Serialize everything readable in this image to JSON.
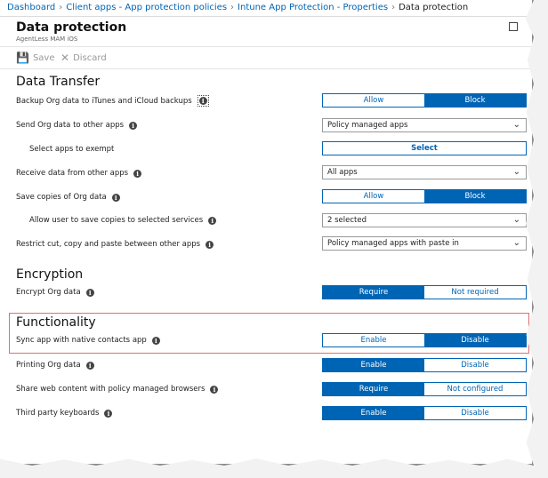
{
  "breadcrumb": {
    "items": [
      "Dashboard",
      "Client apps - App protection policies",
      "Intune App Protection - Properties"
    ],
    "current": "Data protection"
  },
  "header": {
    "title": "Data protection",
    "subtitle": "AgentLess MAM iOS"
  },
  "toolbar": {
    "save_label": "Save",
    "discard_label": "Discard"
  },
  "sections": {
    "data_transfer": "Data Transfer",
    "encryption": "Encryption",
    "functionality": "Functionality"
  },
  "rows": {
    "backup": {
      "label": "Backup Org data to iTunes and iCloud backups",
      "options": [
        "Allow",
        "Block"
      ],
      "selected": "Block"
    },
    "send": {
      "label": "Send Org data to other apps",
      "value": "Policy managed apps"
    },
    "exempt": {
      "label": "Select apps to exempt",
      "button": "Select"
    },
    "receive": {
      "label": "Receive data from other apps",
      "value": "All apps"
    },
    "save_copies": {
      "label": "Save copies of Org data",
      "options": [
        "Allow",
        "Block"
      ],
      "selected": "Block"
    },
    "allow_save": {
      "label": "Allow user to save copies to selected services",
      "value": "2 selected"
    },
    "restrict": {
      "label": "Restrict cut, copy and paste between other apps",
      "value": "Policy managed apps with paste in"
    },
    "encrypt": {
      "label": "Encrypt Org data",
      "options": [
        "Require",
        "Not required"
      ],
      "selected": "Require"
    },
    "sync": {
      "label": "Sync app with native contacts app",
      "options": [
        "Enable",
        "Disable"
      ],
      "selected": "Disable"
    },
    "printing": {
      "label": "Printing Org data",
      "options": [
        "Enable",
        "Disable"
      ],
      "selected": "Enable"
    },
    "share_web": {
      "label": "Share web content with policy managed browsers",
      "options": [
        "Require",
        "Not configured"
      ],
      "selected": "Require"
    },
    "keyboards": {
      "label": "Third party keyboards",
      "options": [
        "Enable",
        "Disable"
      ],
      "selected": "Enable"
    }
  },
  "colors": {
    "accent": "#0064b4",
    "highlight": "#e07070"
  }
}
